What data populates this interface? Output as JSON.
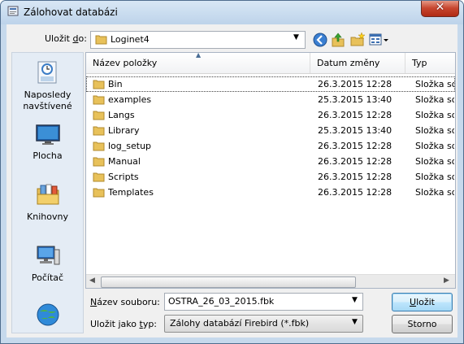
{
  "window": {
    "title": "Zálohovat databázi",
    "close_glyph": "✕"
  },
  "toolbar": {
    "save_in_label_prefix": "Uložit ",
    "save_in_label_key": "d",
    "save_in_label_suffix": "o:",
    "location_value": "Loginet4",
    "buttons": [
      "back-icon",
      "up-folder-icon",
      "new-folder-icon",
      "view-menu-icon"
    ]
  },
  "places": [
    {
      "icon": "recent-places-icon",
      "label_line1": "Naposledy",
      "label_line2": "navštívené"
    },
    {
      "icon": "desktop-icon",
      "label_line1": "Plocha",
      "label_line2": ""
    },
    {
      "icon": "libraries-icon",
      "label_line1": "Knihovny",
      "label_line2": ""
    },
    {
      "icon": "computer-icon",
      "label_line1": "Počítač",
      "label_line2": ""
    },
    {
      "icon": "network-icon",
      "label_line1": "",
      "label_line2": ""
    }
  ],
  "list": {
    "columns": [
      "Název položky",
      "Datum změny",
      "Typ"
    ],
    "rows": [
      {
        "name": "Bin",
        "date": "26.3.2015 12:28",
        "type": "Složka sou"
      },
      {
        "name": "examples",
        "date": "25.3.2015 13:40",
        "type": "Složka sou"
      },
      {
        "name": "Langs",
        "date": "26.3.2015 12:28",
        "type": "Složka sou"
      },
      {
        "name": "Library",
        "date": "25.3.2015 13:40",
        "type": "Složka sou"
      },
      {
        "name": "log_setup",
        "date": "26.3.2015 12:28",
        "type": "Složka sou"
      },
      {
        "name": "Manual",
        "date": "26.3.2015 12:28",
        "type": "Složka sou"
      },
      {
        "name": "Scripts",
        "date": "26.3.2015 12:28",
        "type": "Složka sou"
      },
      {
        "name": "Templates",
        "date": "26.3.2015 12:28",
        "type": "Složka sou"
      }
    ],
    "selected_row": 0
  },
  "form": {
    "filename_label_key": "N",
    "filename_label_rest": "ázev souboru:",
    "filename_value": "OSTRA_26_03_2015.fbk",
    "filetype_label_prefix": "Uložit jako ",
    "filetype_label_key": "t",
    "filetype_label_suffix": "yp:",
    "filetype_value": "Zálohy databází Firebird (*.fbk)"
  },
  "buttons": {
    "save_key": "U",
    "save_rest": "ložit",
    "cancel": "Storno"
  },
  "colors": {
    "titlebar": "#c6d9ec",
    "folder": "#e8c15a",
    "default_button": "#a7d9f5"
  }
}
